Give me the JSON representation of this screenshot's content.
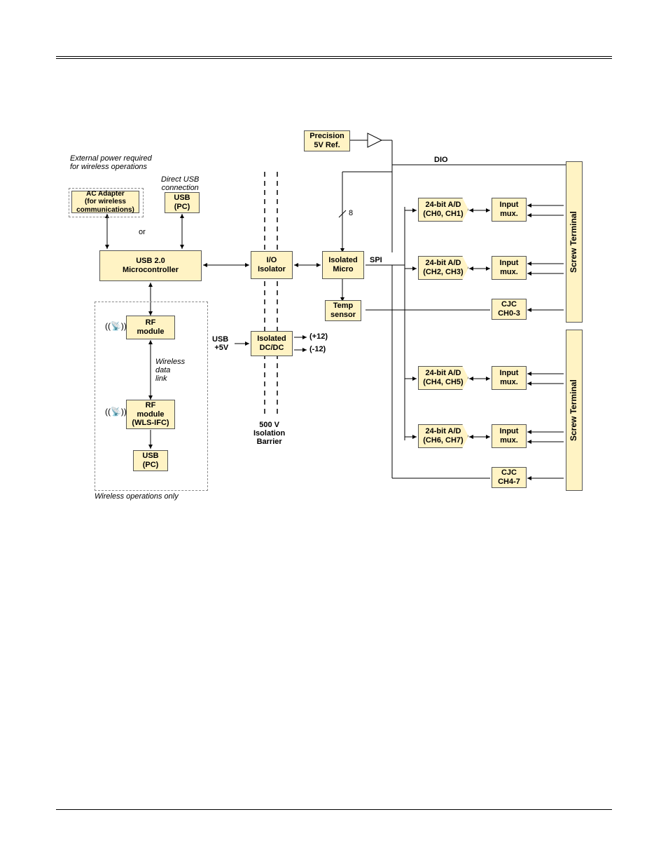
{
  "notes": {
    "ext_power": "External power required\nfor wireless operations",
    "direct_usb": "Direct USB\nconnection",
    "or": "or",
    "wireless_link": "Wireless\ndata\nlink",
    "wireless_only": "Wireless operations only",
    "usb_5v": "USB\n+5V",
    "iso_barrier": "500 V\nIsolation\nBarrier",
    "plus12": "(+12)",
    "minus12": "(-12)",
    "dio": "DIO",
    "spi": "SPI",
    "bus8": "8"
  },
  "blocks": {
    "ac_adapter": "AC Adapter\n(for wireless\ncommunications)",
    "usb_pc_top": "USB\n(PC)",
    "usb_micro": "USB 2.0\nMicrocontroller",
    "rf_module": "RF\nmodule",
    "rf_module_ifc": "RF\nmodule\n(WLS-IFC)",
    "usb_pc_bot": "USB\n(PC)",
    "io_isolator": "I/O\nIsolator",
    "iso_dcdc": "Isolated\nDC/DC",
    "precision_ref": "Precision\n5V Ref.",
    "iso_micro": "Isolated\nMicro",
    "temp_sensor": "Temp\nsensor",
    "ad01": "24-bit A/D\n(CH0, CH1)",
    "ad23": "24-bit A/D\n(CH2, CH3)",
    "ad45": "24-bit A/D\n(CH4, CH5)",
    "ad67": "24-bit A/D\n(CH6, CH7)",
    "mux": "Input\nmux.",
    "cjc03": "CJC\nCH0-3",
    "cjc47": "CJC\nCH4-7",
    "screw_terminal": "Screw Terminal"
  }
}
